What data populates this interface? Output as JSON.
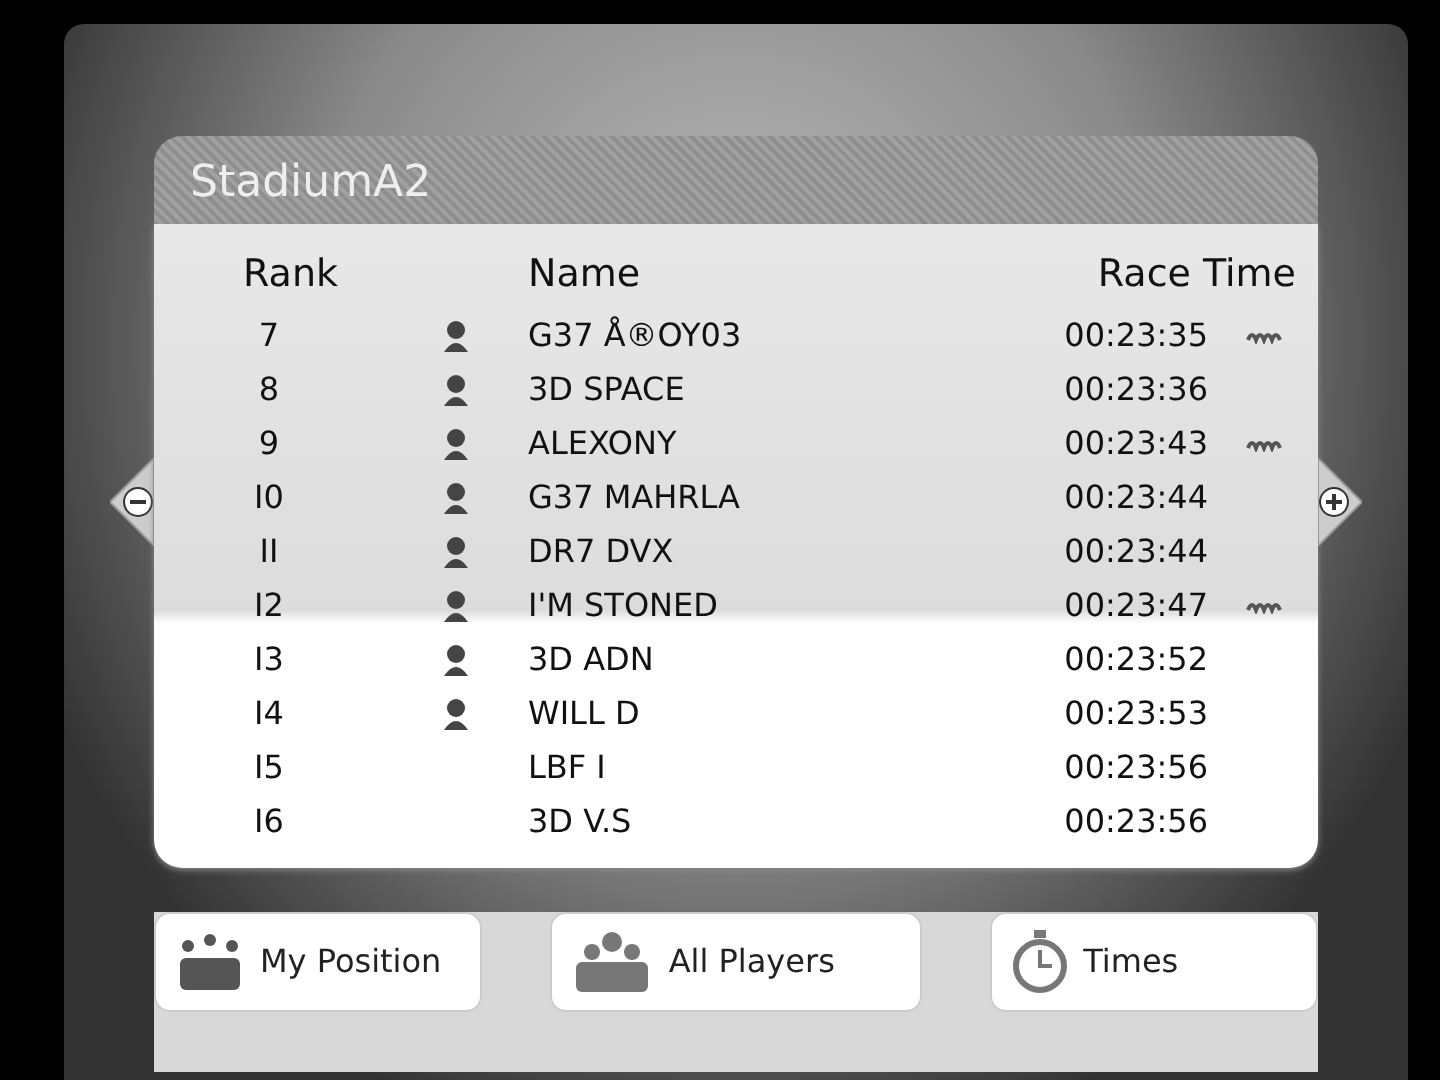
{
  "board": {
    "title": "StadiumA2",
    "columns": [
      "Rank",
      "Name",
      "Race Time"
    ],
    "rows": [
      {
        "rank": "7",
        "avatar": true,
        "name": "G37 Å®OY03",
        "time": "00:23:35",
        "ghost": true
      },
      {
        "rank": "8",
        "avatar": true,
        "name": "3D SPACE",
        "time": "00:23:36",
        "ghost": false
      },
      {
        "rank": "9",
        "avatar": true,
        "name": "ALEXONY",
        "time": "00:23:43",
        "ghost": true
      },
      {
        "rank": "I0",
        "avatar": true,
        "name": "G37 MAHRLA",
        "time": "00:23:44",
        "ghost": false
      },
      {
        "rank": "II",
        "avatar": true,
        "name": "DR7 DVX",
        "time": "00:23:44",
        "ghost": false
      },
      {
        "rank": "I2",
        "avatar": true,
        "name": "I'M STONED",
        "time": "00:23:47",
        "ghost": true
      },
      {
        "rank": "I3",
        "avatar": true,
        "name": "3D ADN",
        "time": "00:23:52",
        "ghost": false
      },
      {
        "rank": "I4",
        "avatar": true,
        "name": "WILL D",
        "time": "00:23:53",
        "ghost": false
      },
      {
        "rank": "I5",
        "avatar": false,
        "name": "LBF I",
        "time": "00:23:56",
        "ghost": false
      },
      {
        "rank": "I6",
        "avatar": false,
        "name": "3D V.S",
        "time": "00:23:56",
        "ghost": false
      }
    ]
  },
  "buttons": [
    {
      "kind": "position",
      "label": "My Position"
    },
    {
      "kind": "players",
      "label": "All Players"
    },
    {
      "kind": "times",
      "label": "Times"
    }
  ]
}
